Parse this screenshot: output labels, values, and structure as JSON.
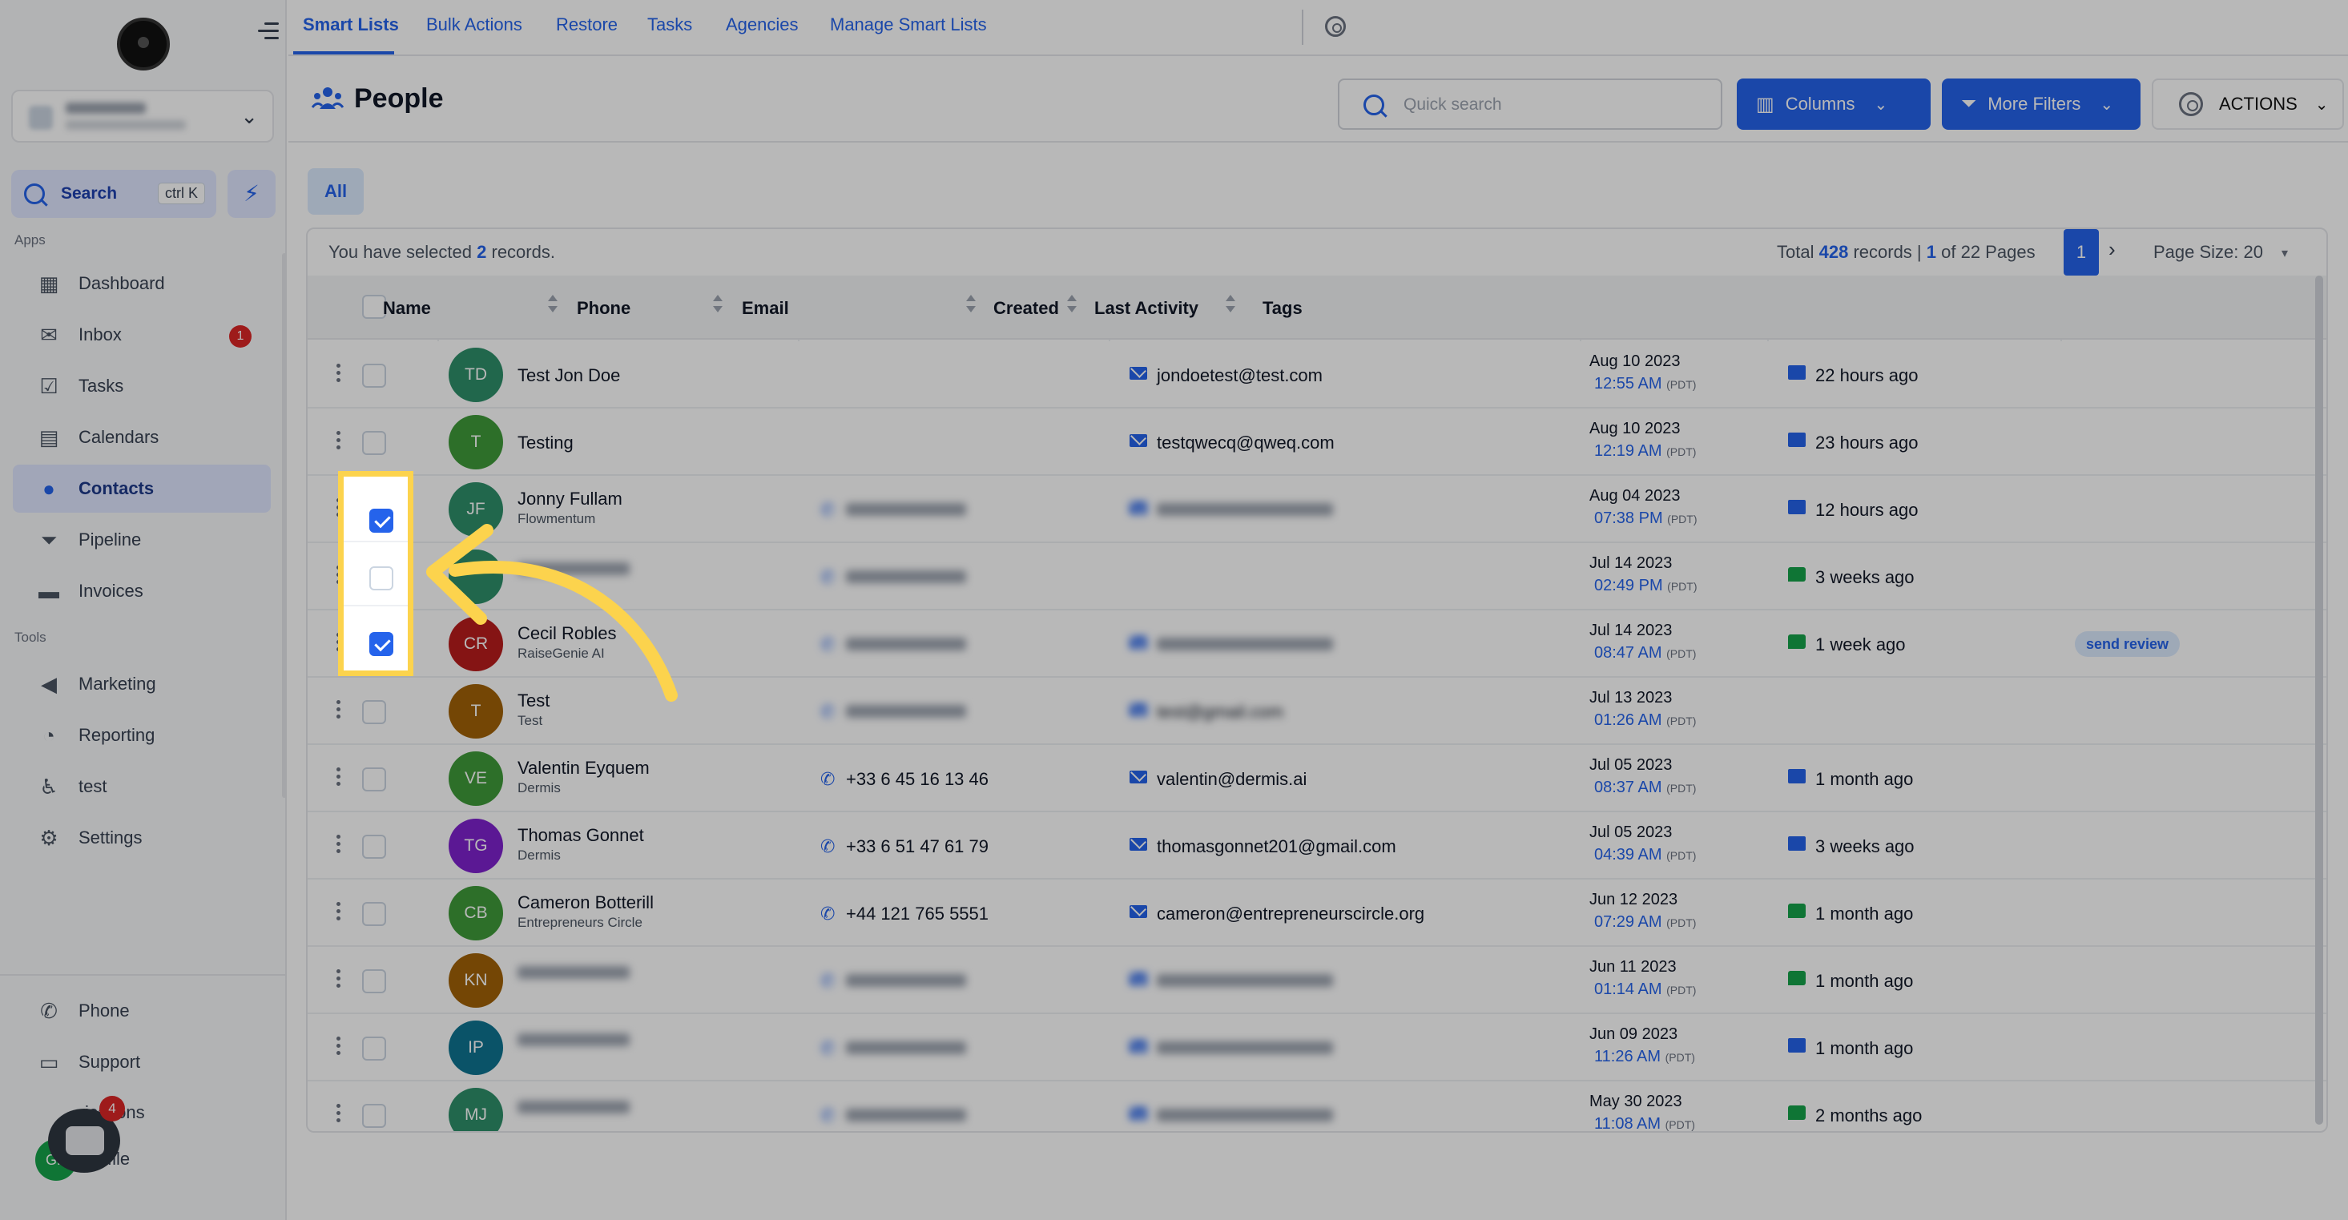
{
  "sidebar": {
    "search_label": "Search",
    "search_shortcut": "ctrl K",
    "apps_label": "Apps",
    "tools_label": "Tools",
    "apps": [
      {
        "label": "Dashboard",
        "icon": "dashboard-icon"
      },
      {
        "label": "Inbox",
        "icon": "inbox-icon",
        "badge": "1"
      },
      {
        "label": "Tasks",
        "icon": "tasks-icon"
      },
      {
        "label": "Calendars",
        "icon": "calendar-icon"
      },
      {
        "label": "Contacts",
        "icon": "contacts-icon",
        "active": true
      },
      {
        "label": "Pipeline",
        "icon": "pipeline-icon"
      },
      {
        "label": "Invoices",
        "icon": "invoices-icon"
      }
    ],
    "tools": [
      {
        "label": "Marketing",
        "icon": "megaphone-icon"
      },
      {
        "label": "Reporting",
        "icon": "pie-chart-icon"
      },
      {
        "label": "test",
        "icon": "accessibility-icon"
      },
      {
        "label": "Settings",
        "icon": "gear-icon"
      }
    ],
    "bottom": [
      {
        "label": "Phone",
        "icon": "phone-icon"
      },
      {
        "label": "Support",
        "icon": "chat-icon"
      }
    ],
    "notifications_label": "ications",
    "notifications_badge": "4",
    "profile_label": "file",
    "profile_initials": "GP"
  },
  "topnav": {
    "tabs": [
      "Smart Lists",
      "Bulk Actions",
      "Restore",
      "Tasks",
      "Agencies",
      "Manage Smart Lists"
    ]
  },
  "header": {
    "title": "People",
    "search_placeholder": "Quick search",
    "columns_label": "Columns",
    "filters_label": "More Filters",
    "actions_label": "ACTIONS"
  },
  "filter_tab": "All",
  "selection": {
    "prefix": "You have selected",
    "count": "2",
    "suffix": "records."
  },
  "pagination": {
    "total_prefix": "Total",
    "total": "428",
    "total_mid": "records |",
    "page": "1",
    "pages_suffix": "of 22 Pages",
    "current_page": "1",
    "page_size_label": "Page Size: 20"
  },
  "columns": [
    "Name",
    "Phone",
    "Email",
    "Created",
    "Last Activity",
    "Tags"
  ],
  "rows": [
    {
      "initials": "TD",
      "color": "#2f8f6a",
      "name": "Test Jon Doe",
      "company": "",
      "phone": "",
      "email": "jondoetest@test.com",
      "date": "Aug 10 2023",
      "time": "12:55 AM",
      "tz": "(PDT)",
      "activity": "22 hours ago",
      "activity_type": "mail",
      "tag": "",
      "checked": false,
      "blurred": false
    },
    {
      "initials": "T",
      "color": "#3f9a3a",
      "name": "Testing",
      "company": "",
      "phone": "",
      "email": "testqwecq@qweq.com",
      "date": "Aug 10 2023",
      "time": "12:19 AM",
      "tz": "(PDT)",
      "activity": "23 hours ago",
      "activity_type": "mail",
      "tag": "",
      "checked": false,
      "blurred": false
    },
    {
      "initials": "JF",
      "color": "#2f8f6a",
      "name": "Jonny Fullam",
      "company": "Flowmentum",
      "phone": "",
      "email": "",
      "date": "Aug 04 2023",
      "time": "07:38 PM",
      "tz": "(PDT)",
      "activity": "12 hours ago",
      "activity_type": "mail",
      "tag": "",
      "checked": true,
      "blurred": true
    },
    {
      "initials": "",
      "color": "#2f8f6a",
      "name": "",
      "company": "",
      "phone": "",
      "email": "",
      "date": "Jul 14 2023",
      "time": "02:49 PM",
      "tz": "(PDT)",
      "activity": "3 weeks ago",
      "activity_type": "sms",
      "tag": "",
      "checked": false,
      "blurred": true
    },
    {
      "initials": "CR",
      "color": "#b91c1c",
      "name": "Cecil Robles",
      "company": "RaiseGenie AI",
      "phone": "",
      "email": "",
      "date": "Jul 14 2023",
      "time": "08:47 AM",
      "tz": "(PDT)",
      "activity": "1 week ago",
      "activity_type": "sms",
      "tag": "send review",
      "checked": true,
      "blurred": true
    },
    {
      "initials": "T",
      "color": "#a16207",
      "name": "Test",
      "company": "Test",
      "phone": "",
      "email": "test@gmail.com",
      "date": "Jul 13 2023",
      "time": "01:26 AM",
      "tz": "(PDT)",
      "activity": "",
      "activity_type": "",
      "tag": "",
      "checked": false,
      "blurred": true
    },
    {
      "initials": "VE",
      "color": "#3f9a3a",
      "name": "Valentin Eyquem",
      "company": "Dermis",
      "phone": "+33 6 45 16 13 46",
      "email": "valentin@dermis.ai",
      "date": "Jul 05 2023",
      "time": "08:37 AM",
      "tz": "(PDT)",
      "activity": "1 month ago",
      "activity_type": "mail",
      "tag": "",
      "checked": false,
      "blurred": false
    },
    {
      "initials": "TG",
      "color": "#7e22ce",
      "name": "Thomas Gonnet",
      "company": "Dermis",
      "phone": "+33 6 51 47 61 79",
      "email": "thomasgonnet201@gmail.com",
      "date": "Jul 05 2023",
      "time": "04:39 AM",
      "tz": "(PDT)",
      "activity": "3 weeks ago",
      "activity_type": "mail",
      "tag": "",
      "checked": false,
      "blurred": false
    },
    {
      "initials": "CB",
      "color": "#3f9a3a",
      "name": "Cameron Botterill",
      "company": "Entrepreneurs Circle",
      "phone": "+44 121 765 5551",
      "email": "cameron@entrepreneurscircle.org",
      "date": "Jun 12 2023",
      "time": "07:29 AM",
      "tz": "(PDT)",
      "activity": "1 month ago",
      "activity_type": "sms",
      "tag": "",
      "checked": false,
      "blurred": false
    },
    {
      "initials": "KN",
      "color": "#a16207",
      "name": "",
      "company": "",
      "phone": "",
      "email": "",
      "date": "Jun 11 2023",
      "time": "01:14 AM",
      "tz": "(PDT)",
      "activity": "1 month ago",
      "activity_type": "sms",
      "tag": "",
      "checked": false,
      "blurred": true
    },
    {
      "initials": "IP",
      "color": "#0e7490",
      "name": "",
      "company": "",
      "phone": "",
      "email": "",
      "date": "Jun 09 2023",
      "time": "11:26 AM",
      "tz": "(PDT)",
      "activity": "1 month ago",
      "activity_type": "mail",
      "tag": "",
      "checked": false,
      "blurred": true
    },
    {
      "initials": "MJ",
      "color": "#2f8f6a",
      "name": "",
      "company": "",
      "phone": "",
      "email": "",
      "date": "May 30 2023",
      "time": "11:08 AM",
      "tz": "(PDT)",
      "activity": "2 months ago",
      "activity_type": "sms",
      "tag": "",
      "checked": false,
      "blurred": true
    }
  ],
  "colors": {
    "accent": "#2563eb",
    "highlight": "#fcd34d",
    "badge": "#dc2626"
  }
}
